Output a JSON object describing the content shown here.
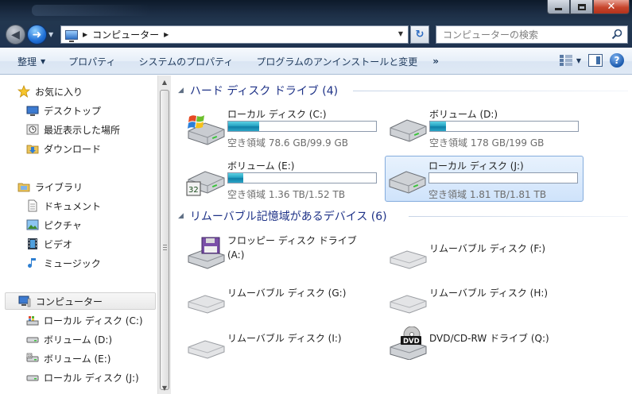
{
  "address": {
    "crumbs": [
      "コンピューター"
    ],
    "search_placeholder": "コンピューターの検索"
  },
  "toolbar": {
    "organize": "整理",
    "properties": "プロパティ",
    "system_properties": "システムのプロパティ",
    "uninstall": "プログラムのアンインストールと変更",
    "more": "»"
  },
  "nav": {
    "favorites": "お気に入り",
    "desktop": "デスクトップ",
    "recent": "最近表示した場所",
    "downloads": "ダウンロード",
    "libraries": "ライブラリ",
    "documents": "ドキュメント",
    "pictures": "ピクチャ",
    "videos": "ビデオ",
    "music": "ミュージック",
    "computer": "コンピューター",
    "drive_c": "ローカル ディスク (C:)",
    "drive_d": "ボリューム (D:)",
    "drive_e": "ボリューム (E:)",
    "drive_j": "ローカル ディスク (J:)"
  },
  "groups": {
    "hdd_title": "ハード ディスク ドライブ (4)",
    "removable_title": "リムーバブル記憶域があるデバイス (6)"
  },
  "hard_drives": [
    {
      "name": "ローカル ディスク (C:)",
      "free": "空き領域 78.6 GB/99.9 GB",
      "used_fraction": 0.21,
      "icon": "windows-drive-icon"
    },
    {
      "name": "ボリューム (D:)",
      "free": "空き領域 178 GB/199 GB",
      "used_fraction": 0.11,
      "icon": "hard-drive-icon"
    },
    {
      "name": "ボリューム (E:)",
      "free": "空き領域 1.36 TB/1.52 TB",
      "used_fraction": 0.1,
      "icon": "hard-drive-icon"
    },
    {
      "name": "ローカル ディスク (J:)",
      "free": "空き領域 1.81 TB/1.81 TB",
      "used_fraction": 0.0,
      "icon": "hard-drive-icon"
    }
  ],
  "removable": [
    {
      "name_line1": "フロッピー ディスク ドライブ",
      "name_line2": "(A:)",
      "icon": "floppy-drive-icon"
    },
    {
      "name_line1": "リムーバブル ディスク (F:)",
      "name_line2": "",
      "icon": "removable-disk-icon"
    },
    {
      "name_line1": "リムーバブル ディスク (G:)",
      "name_line2": "",
      "icon": "removable-disk-icon"
    },
    {
      "name_line1": "リムーバブル ディスク (H:)",
      "name_line2": "",
      "icon": "removable-disk-icon"
    },
    {
      "name_line1": "リムーバブル ディスク (I:)",
      "name_line2": "",
      "icon": "removable-disk-icon"
    },
    {
      "name_line1": "DVD/CD-RW ドライブ (Q:)",
      "name_line2": "",
      "icon": "dvd-drive-icon",
      "badge": "DVD"
    }
  ]
}
